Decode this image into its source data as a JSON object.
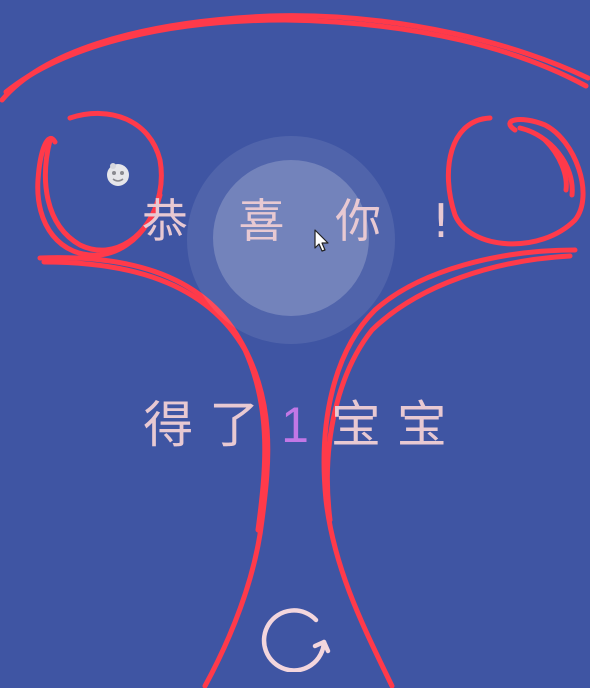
{
  "game": {
    "title": "恭 喜 你 !",
    "result_prefix": "得 了",
    "result_count": "1",
    "result_suffix": "宝 宝"
  },
  "icons": {
    "restart": "restart-circular-arrow-icon",
    "cursor": "mouse-cursor-icon",
    "baby": "baby-icon"
  },
  "colors": {
    "background": "#3f55a3",
    "text": "#e8c9d2",
    "count": "#c277e6",
    "annotation": "#ff3a4a"
  }
}
